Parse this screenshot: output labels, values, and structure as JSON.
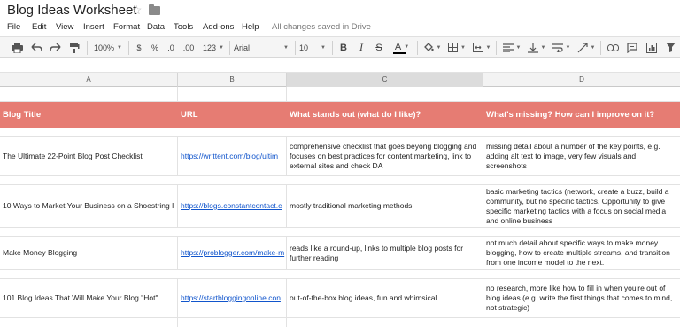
{
  "document": {
    "title": "Blog Ideas Worksheet",
    "save_status": "All changes saved in Drive"
  },
  "menu": [
    "File",
    "Edit",
    "View",
    "Insert",
    "Format",
    "Data",
    "Tools",
    "Add-ons",
    "Help"
  ],
  "toolbar": {
    "zoom": "100%",
    "currency": "$",
    "percent": "%",
    "decrease_decimal": ".0",
    "increase_decimal": ".00",
    "more_formats": "123",
    "font": "Arial",
    "font_size": "10",
    "bold": "B",
    "italic": "I",
    "strikethrough": "S",
    "text_color": "A",
    "text_color_value": "#000000"
  },
  "columns": [
    "A",
    "B",
    "C",
    "D"
  ],
  "selected_column": "C",
  "header": {
    "title": "Blog Title",
    "url": "URL",
    "stands_out": "What stands out (what do I like)?",
    "missing": "What's missing? How can I improve on it?",
    "color": "#e67c73"
  },
  "rows": [
    {
      "title": "The Ultimate 22-Point Blog Post Checklist",
      "url": "https://writtent.com/blog/ultim",
      "stands_out": "comprehensive checklist that goes beyong blogging and focuses on best practices for content marketing, link to external sites and check DA",
      "missing": "missing detail about a number of the key points, e.g. adding alt text to image, very few visuals and screenshots"
    },
    {
      "title": "10 Ways to Market Your Business on a Shoestring I",
      "url": "https://blogs.constantcontact.c",
      "stands_out": "mostly traditional marketing methods",
      "missing": "basic marketing tactics (network, create a buzz, build a community, but no specific tactics. Opportunity to give specific marketing tactics with a focus on social media and online business"
    },
    {
      "title": "Make Money Blogging",
      "url": "https://problogger.com/make-m",
      "stands_out": "reads like a round-up, links to multiple blog posts for further reading",
      "missing": "not much detail about specific ways to make money blogging, how to create multiple streams, and transition from one income model to the next."
    },
    {
      "title": "101 Blog Ideas That Will Make Your Blog \"Hot\"",
      "url": "https://startbloggingonline.con",
      "stands_out": "out-of-the-box blog ideas, fun and whimsical",
      "missing": "no research, more like how to fill in when you're out of blog ideas (e.g. write the first things that comes to mind, not strategic)"
    }
  ]
}
